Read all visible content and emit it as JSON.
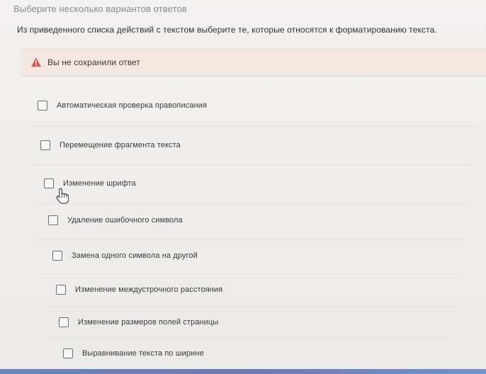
{
  "instruction": "Выберите несколько вариантов ответов",
  "question": "Из приведенного списка действий с текстом выберите те, которые относятся к форматированию текста.",
  "warning": {
    "icon": "warning-icon",
    "color": "#d9534f",
    "text": "Вы не сохранили ответ"
  },
  "options": [
    {
      "label": "Автоматическая проверка правописания",
      "checked": false
    },
    {
      "label": "Перемещение фрагмента текста",
      "checked": false
    },
    {
      "label": "Изменение шрифта",
      "checked": false
    },
    {
      "label": "Удаление ошибочного символа",
      "checked": false
    },
    {
      "label": "Замена одного символа на другой",
      "checked": false
    },
    {
      "label": "Изменение междустрочного расстояния",
      "checked": false
    },
    {
      "label": "Изменение размеров полей страницы",
      "checked": false
    },
    {
      "label": "Выравнивание текста по ширине",
      "checked": false
    }
  ]
}
